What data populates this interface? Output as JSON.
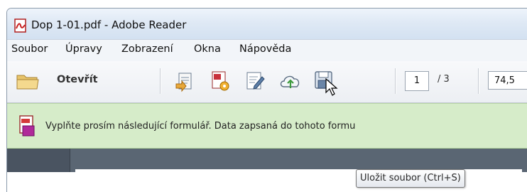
{
  "window": {
    "title": "Dop 1-01.pdf - Adobe Reader"
  },
  "menu": {
    "items": [
      "Soubor",
      "Úpravy",
      "Zobrazení",
      "Okna",
      "Nápověda"
    ]
  },
  "toolbar": {
    "open_label": "Otevřít",
    "page_current": "1",
    "page_total": "/ 3",
    "zoom_value": "74,5"
  },
  "tooltip": {
    "text": "Uložit soubor (Ctrl+S)"
  },
  "formbar": {
    "message": "Vyplňte prosím následující formulář. Data zapsaná do tohoto formu"
  },
  "colors": {
    "title_gradient_top": "#eef4fb",
    "form_bar_background": "#d6ecc9",
    "doc_background": "#5a6673"
  },
  "icons": [
    "pdf-app-icon",
    "folder-open-icon",
    "create-pdf-icon",
    "pdf-settings-icon",
    "edit-form-icon",
    "cloud-upload-icon",
    "save-icon",
    "mouse-cursor-icon",
    "form-pdf-icon"
  ]
}
